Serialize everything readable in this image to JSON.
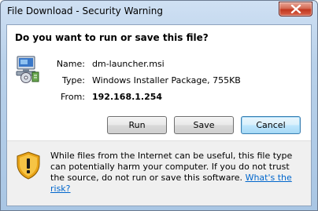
{
  "window": {
    "title": "File Download - Security Warning"
  },
  "dialog": {
    "question": "Do you want to run or save this file?",
    "file": {
      "name_label": "Name:",
      "name_value": "dm-launcher.msi",
      "type_label": "Type:",
      "type_value": "Windows Installer Package, 755KB",
      "from_label": "From:",
      "from_value": "192.168.1.254"
    },
    "buttons": {
      "run": "Run",
      "save": "Save",
      "cancel": "Cancel"
    },
    "warning": {
      "text": "While files from the Internet can be useful, this file type can potentially harm your computer. If you do not trust the source, do not run or save this software. ",
      "link": "What's the risk?"
    }
  },
  "icons": {
    "close": "close-icon",
    "installer": "installer-package-icon",
    "shield": "warning-shield-icon"
  },
  "colors": {
    "link": "#0066cc",
    "close_button": "#c2381f",
    "shield_gold": "#e8a317"
  }
}
